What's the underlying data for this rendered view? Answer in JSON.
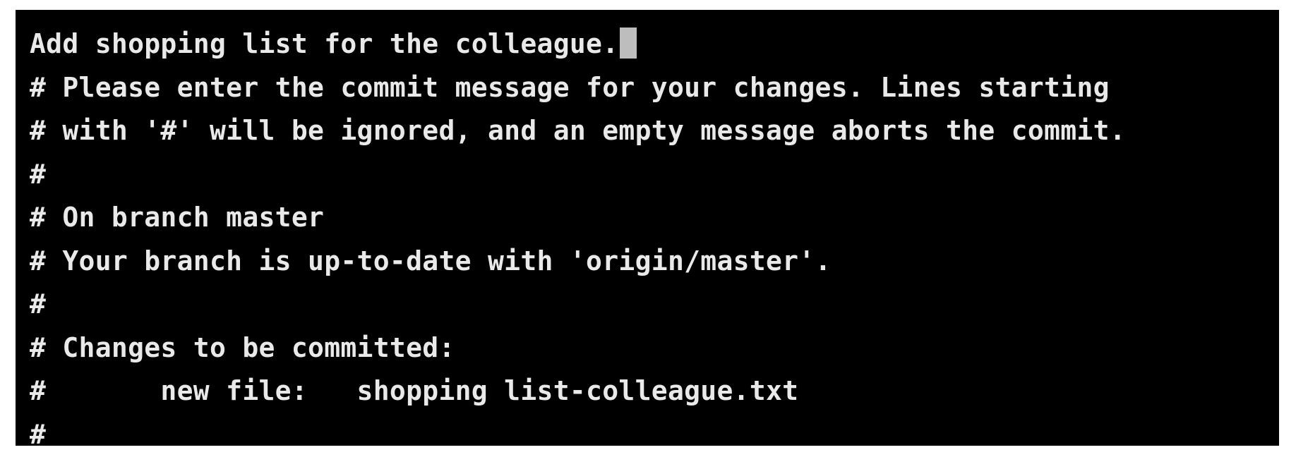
{
  "editor": {
    "lines": [
      "Add shopping list for the colleague.",
      "# Please enter the commit message for your changes. Lines starting",
      "# with '#' will be ignored, and an empty message aborts the commit.",
      "#",
      "# On branch master",
      "# Your branch is up-to-date with 'origin/master'.",
      "#",
      "# Changes to be committed:",
      "#       new file:   shopping list-colleague.txt",
      "#"
    ]
  },
  "colors": {
    "background": "#000000",
    "text": "#e9e9e9",
    "cursor": "#bdbdbd"
  }
}
